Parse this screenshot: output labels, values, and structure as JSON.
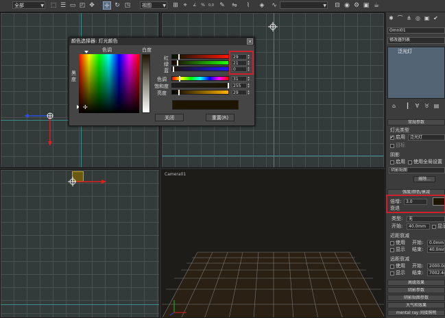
{
  "toolbar": {
    "selection_filter": "全部",
    "coord_system": "视图",
    "snap_percent": "%",
    "spinner_snap": "0,0",
    "named_selection": ""
  },
  "viewports": {
    "camera_label": "Camera01"
  },
  "color_dialog": {
    "title": "颜色选择器: 灯光颜色",
    "hue_label": "色调",
    "whiteness_label": "白度",
    "blackness_label": "黑度",
    "red_label": "红",
    "green_label": "绿",
    "blue_label": "蓝",
    "hue2_label": "色调",
    "saturation_label": "饱和度",
    "value_label": "亮度",
    "red_value": "29",
    "green_value": "21",
    "blue_value": "0",
    "hue_value": "31",
    "saturation_value": "255",
    "brightness_value": "29",
    "close_button": "关闭",
    "reset_button": "重置(R)",
    "swatch_color": "#1d1500"
  },
  "panel": {
    "object_name": "Omni01",
    "modifier_list": "修改器列表",
    "stack_item": "泛光灯",
    "general_rollout": "常规参数",
    "light_type_label": "灯光类型",
    "enable_label": "启用",
    "light_type_value": "泛光灯",
    "targeted_label": "目标",
    "shadows_label": "阴影",
    "shadows_enable": "启用",
    "use_global": "使用全局设置",
    "shadow_map": "阴影贴图",
    "exclude_button": "排除...",
    "intensity_rollout": "强度/颜色/衰减",
    "multiplier_label": "倍增:",
    "multiplier_value": "3.0",
    "decay_label": "衰退",
    "decay_type_label": "类型:",
    "decay_type_value": "无",
    "start_label": "开始:",
    "start_value": "40.0mm",
    "show_label": "显示",
    "near_atten_label": "近距衰减",
    "use_label": "使用",
    "start2_label": "开始:",
    "start2_value": "0.0mm",
    "show2_label": "显示",
    "end_label": "结束:",
    "end_value": "40.0mm",
    "far_atten_label": "远距衰减",
    "use3_label": "使用",
    "start3_label": "开始:",
    "start3_value": "2000.0m",
    "show3_label": "显示",
    "end3_label": "结束:",
    "end3_value": "7002.4m",
    "advanced_rollout": "高级效果",
    "shadow_params_rollout": "阴影参数",
    "shadow_map_params_rollout": "阴影贴图参数",
    "atmosphere_rollout": "大气和效果",
    "mentalray_rollout": "mental ray 间接照明"
  }
}
